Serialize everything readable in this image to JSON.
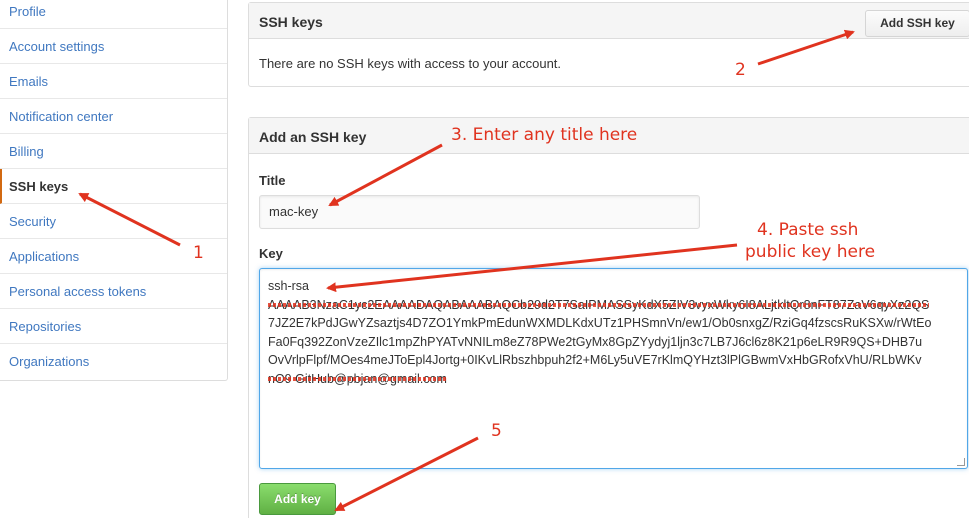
{
  "sidebar": {
    "items": [
      {
        "label": "Profile"
      },
      {
        "label": "Account settings"
      },
      {
        "label": "Emails"
      },
      {
        "label": "Notification center"
      },
      {
        "label": "Billing"
      },
      {
        "label": "SSH keys",
        "selected": true
      },
      {
        "label": "Security"
      },
      {
        "label": "Applications"
      },
      {
        "label": "Personal access tokens"
      },
      {
        "label": "Repositories"
      },
      {
        "label": "Organizations"
      }
    ]
  },
  "ssh_keys_box": {
    "title": "SSH keys",
    "add_button": "Add SSH key",
    "empty_message": "There are no SSH keys with access to your account."
  },
  "add_key_box": {
    "title": "Add an SSH key",
    "title_label": "Title",
    "title_value": "mac-key",
    "key_label": "Key",
    "key_lines": [
      "ssh-rsa",
      "AAAAB3NzaC1yc2EAAAADAQABAAABAQCb29d2T7SaIPMASSyKdX5ZIV3vyxWky6I8ALjtkltQr8nFT87ZaV6qyXz2QS",
      "7JZ2E7kPdJGwYZsaztjs4D7ZO1YmkPmEdunWXMDLKdxUTz1PHSmnVn/ew1/Ob0snxgZ/RziGq4fzscsRuKSXw/rWtEo",
      "Fa0Fq392ZonVzeZIlc1mpZhPYATvNNILm8eZ78PWe2tGyMx8GpZYydyj1ljn3c7LB7J6cl6z8K21p6eLR9R9QS+DHB7u",
      "OvVrlpFlpf/MOes4meJToEpl4Jortg+0IKvLlRbszhbpuh2f2+M6Ly5uVE7rKlmQYHzt3lPlGBwmVxHbGRofxVhU/RLbWKv",
      "nO9 GitHub@pbjan@gmail.com"
    ],
    "add_button": "Add key"
  },
  "annotations": {
    "step1": "1",
    "step2": "2",
    "step3": "3. Enter any title here",
    "step4_line1": "4. Paste ssh",
    "step4_line2": "public key here",
    "step5": "5"
  },
  "colors": {
    "annotation": "#e0331f",
    "link": "#4078c0",
    "primary_button": "#60b044",
    "focus_border": "#51a7e8"
  }
}
